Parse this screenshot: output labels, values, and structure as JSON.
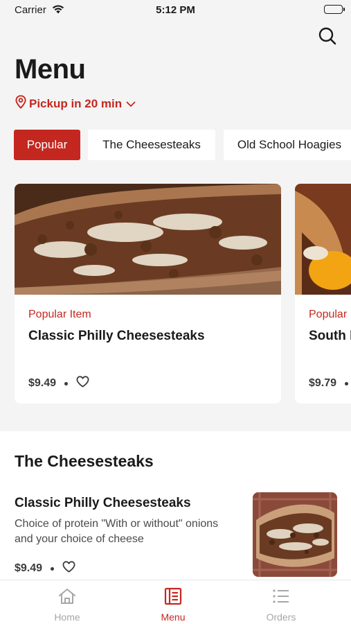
{
  "status_bar": {
    "carrier": "Carrier",
    "time": "5:12 PM"
  },
  "header": {
    "title": "Menu",
    "pickup_label": "Pickup in 20 min"
  },
  "categories": [
    "Popular",
    "The Cheesesteaks",
    "Old School Hoagies"
  ],
  "featured": [
    {
      "kicker": "Popular Item",
      "name": "Classic Philly Cheesesteaks",
      "price": "$9.49"
    },
    {
      "kicker": "Popular Item",
      "name": "South Philly Cheesesteak",
      "price": "$9.79"
    }
  ],
  "section": {
    "title": "The Cheesesteaks",
    "items": [
      {
        "name": "Classic Philly Cheesesteaks",
        "description": "Choice of protein \"With or without\" onions and your choice of cheese",
        "price": "$9.49"
      }
    ]
  },
  "tab_bar": {
    "home_label": "Home",
    "menu_label": "Menu",
    "orders_label": "Orders",
    "active": "Menu"
  },
  "colors": {
    "accent": "#c4271f",
    "background": "#f4f4f4",
    "surface": "#ffffff",
    "inactive": "#a6a6a6"
  },
  "icons": [
    "wifi-icon",
    "battery-icon",
    "search-icon",
    "location-pin-icon",
    "chevron-down-icon",
    "heart-icon",
    "home-icon",
    "menu-icon",
    "orders-icon"
  ]
}
